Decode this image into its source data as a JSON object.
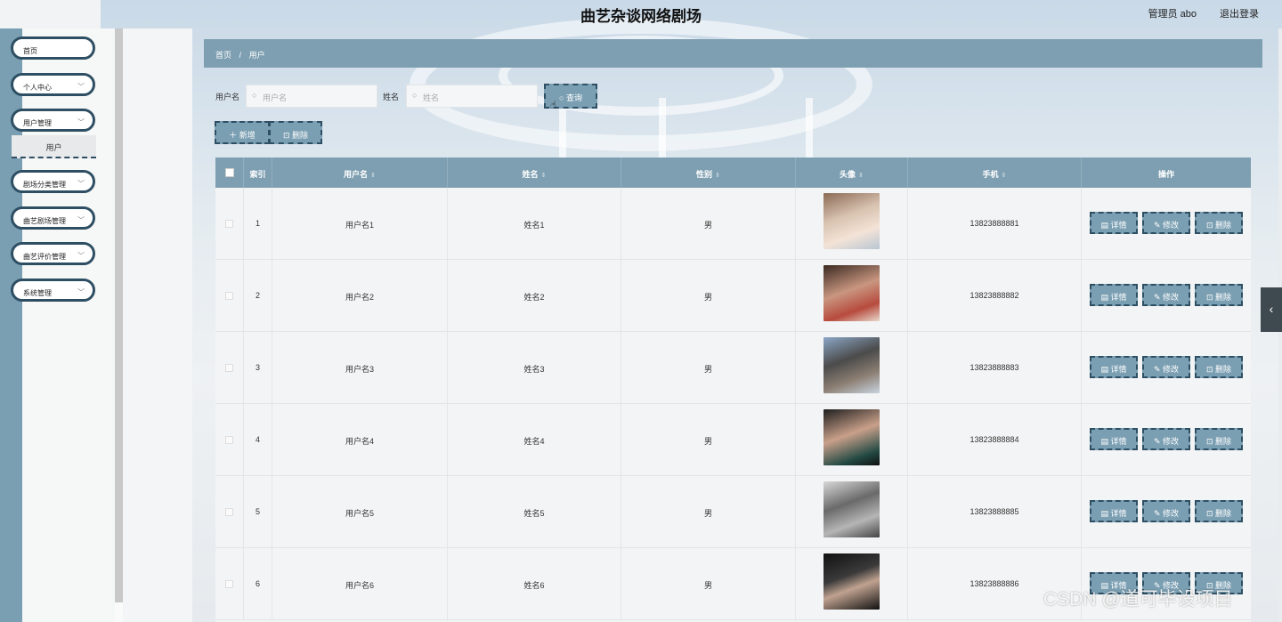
{
  "header": {
    "title": "曲艺杂谈网络剧场",
    "admin_label": "管理员 abo",
    "logout_label": "退出登录"
  },
  "sidebar": {
    "items": [
      {
        "label": "首页",
        "has_chevron": false
      },
      {
        "label": "个人中心",
        "has_chevron": true
      },
      {
        "label": "用户管理",
        "has_chevron": true
      },
      {
        "label": "剧场分类管理",
        "has_chevron": true
      },
      {
        "label": "曲艺剧场管理",
        "has_chevron": true
      },
      {
        "label": "曲艺评价管理",
        "has_chevron": true
      },
      {
        "label": "系统管理",
        "has_chevron": true
      }
    ],
    "submenu_label": "用户"
  },
  "breadcrumb": {
    "home": "首页",
    "separator": "/",
    "current": "用户"
  },
  "search": {
    "username_label": "用户名",
    "username_placeholder": "用户名",
    "name_label": "姓名",
    "name_placeholder": "姓名",
    "query_button": "查询"
  },
  "toolbar": {
    "add_button": "新增",
    "delete_button": "删除"
  },
  "table": {
    "columns": [
      "索引",
      "用户名",
      "姓名",
      "性别",
      "头像",
      "手机",
      "操作"
    ],
    "rows": [
      {
        "index": "1",
        "username": "用户名1",
        "name": "姓名1",
        "gender": "男",
        "phone": "13823888881"
      },
      {
        "index": "2",
        "username": "用户名2",
        "name": "姓名2",
        "gender": "男",
        "phone": "13823888882"
      },
      {
        "index": "3",
        "username": "用户名3",
        "name": "姓名3",
        "gender": "男",
        "phone": "13823888883"
      },
      {
        "index": "4",
        "username": "用户名4",
        "name": "姓名4",
        "gender": "男",
        "phone": "13823888884"
      },
      {
        "index": "5",
        "username": "用户名5",
        "name": "姓名5",
        "gender": "男",
        "phone": "13823888885"
      },
      {
        "index": "6",
        "username": "用户名6",
        "name": "姓名6",
        "gender": "男",
        "phone": "13823888886"
      }
    ],
    "actions": {
      "detail": "详情",
      "edit": "修改",
      "delete": "删除"
    }
  },
  "watermark": "CSDN @道可毕设项目",
  "colors": {
    "accent": "#7b9fb2",
    "accent_dark": "#2e4f63",
    "header_bg": "#7e9fb1"
  }
}
